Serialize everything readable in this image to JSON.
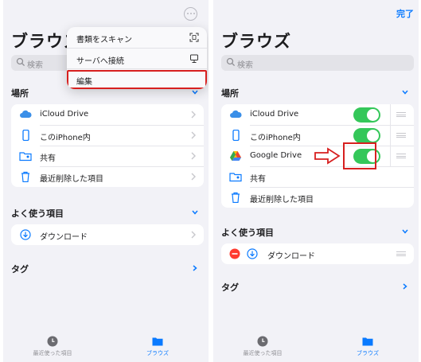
{
  "left": {
    "title": "ブラウズ",
    "search_placeholder": "検索",
    "section_places": "場所",
    "places": [
      "iCloud Drive",
      "このiPhone内",
      "共有",
      "最近削除した項目"
    ],
    "section_favorites": "よく使う項目",
    "favorites": [
      "ダウンロード"
    ],
    "section_tags": "タグ",
    "menu": [
      {
        "label": "書類をスキャン",
        "icon": "scan-icon"
      },
      {
        "label": "サーバへ接続",
        "icon": "monitor-icon"
      },
      {
        "label": "編集",
        "icon": ""
      }
    ],
    "tabs": [
      "最近使った項目",
      "ブラウズ"
    ]
  },
  "right": {
    "done": "完了",
    "title": "ブラウズ",
    "search_placeholder": "検索",
    "section_places": "場所",
    "places": [
      "iCloud Drive",
      "このiPhone内",
      "Google Drive",
      "共有",
      "最近削除した項目"
    ],
    "section_favorites": "よく使う項目",
    "favorites": [
      "ダウンロード"
    ],
    "section_tags": "タグ",
    "tabs": [
      "最近使った項目",
      "ブラウズ"
    ]
  },
  "colors": {
    "accent": "#0a7aff",
    "toggle_on": "#34c759",
    "highlight": "#d71f1f",
    "delete": "#ff3b30"
  }
}
